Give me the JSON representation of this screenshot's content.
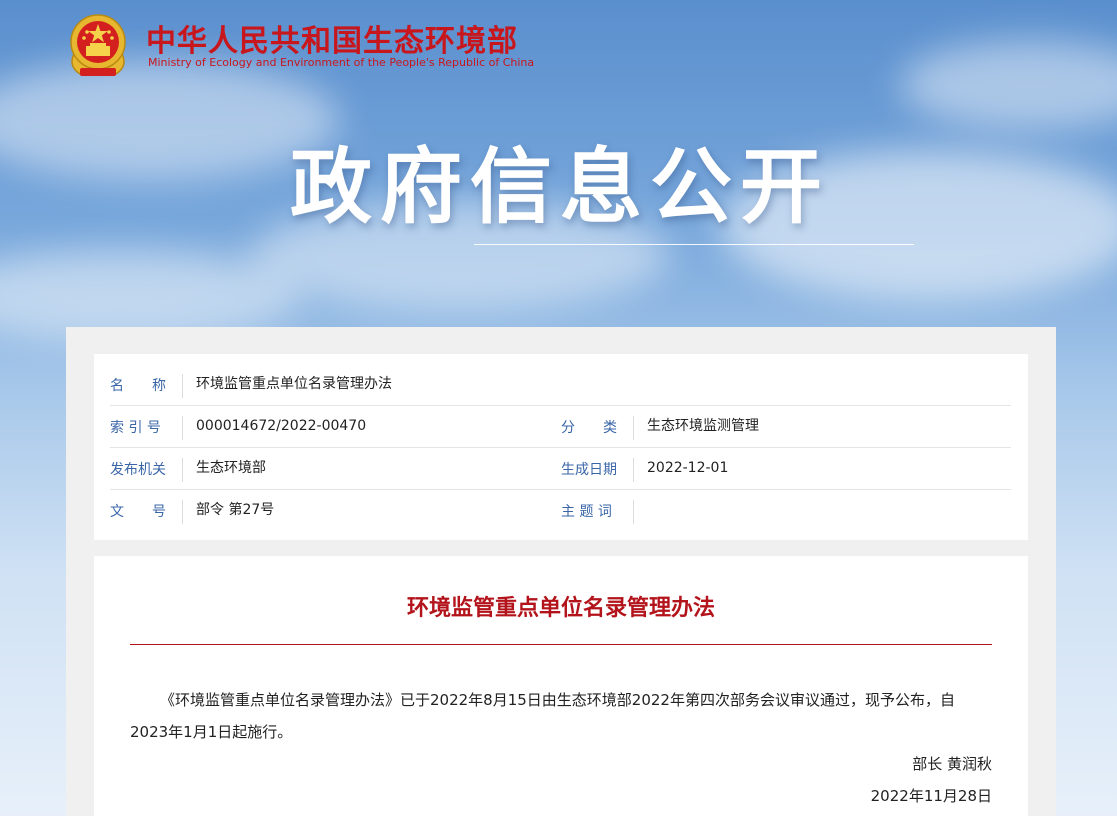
{
  "header": {
    "site_name_cn": "中华人民共和国生态环境部",
    "site_name_en": "Ministry of Ecology and Environment of the People's Republic of China",
    "emblem_icon": "national-emblem-icon"
  },
  "banner": {
    "title": "政府信息公开"
  },
  "info": {
    "name_label": "名　　称",
    "name_value": "环境监管重点单位名录管理办法",
    "index_label": "索 引 号",
    "index_value": "000014672/2022-00470",
    "category_label": "分　　类",
    "category_value": "生态环境监测管理",
    "issuer_label": "发布机关",
    "issuer_value": "生态环境部",
    "date_label": "生成日期",
    "date_value": "2022-12-01",
    "doc_no_label": "文　　号",
    "doc_no_value": "部令 第27号",
    "keywords_label": "主 题 词",
    "keywords_value": ""
  },
  "document": {
    "title": "环境监管重点单位名录管理办法",
    "body": "《环境监管重点单位名录管理办法》已于2022年8月15日由生态环境部2022年第四次部务会议审议通过，现予公布，自2023年1月1日起施行。",
    "signer": "部长 黄润秋",
    "date": "2022年11月28日"
  },
  "colors": {
    "brand_red": "#c8161d",
    "label_blue": "#3a66a8"
  }
}
